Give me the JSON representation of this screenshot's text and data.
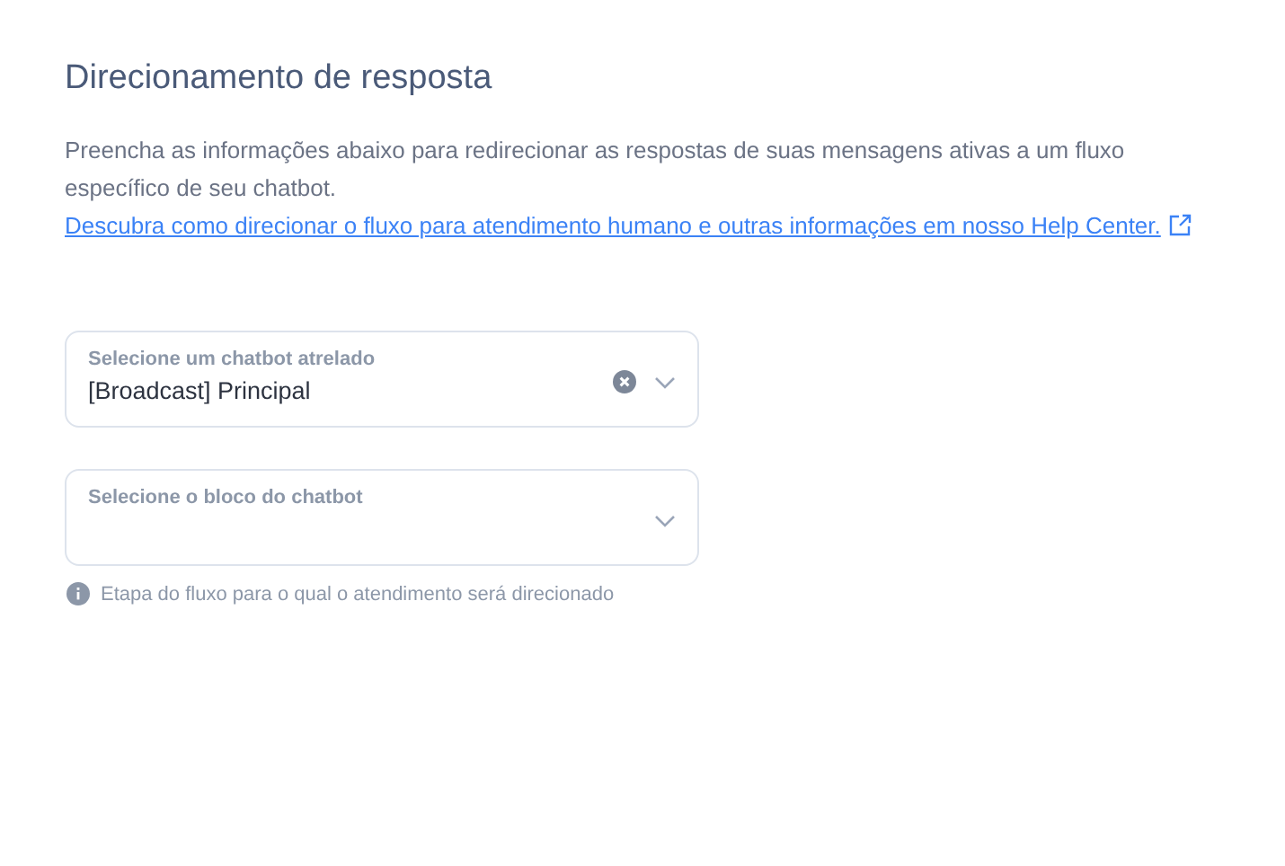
{
  "title": "Direcionamento de resposta",
  "description": {
    "text": "Preencha as informações abaixo para redirecionar as respostas de suas mensagens ativas a um fluxo específico de seu chatbot.",
    "link": "Descubra como direcionar o fluxo para atendimento humano e outras informações em nosso Help Center."
  },
  "selects": [
    {
      "label": "Selecione um chatbot atrelado",
      "value": "[Broadcast] Principal",
      "clearable": true
    },
    {
      "label": "Selecione o bloco do chatbot",
      "clearable": false,
      "hint": "Etapa do fluxo para o qual o atendimento será direcionado"
    }
  ]
}
